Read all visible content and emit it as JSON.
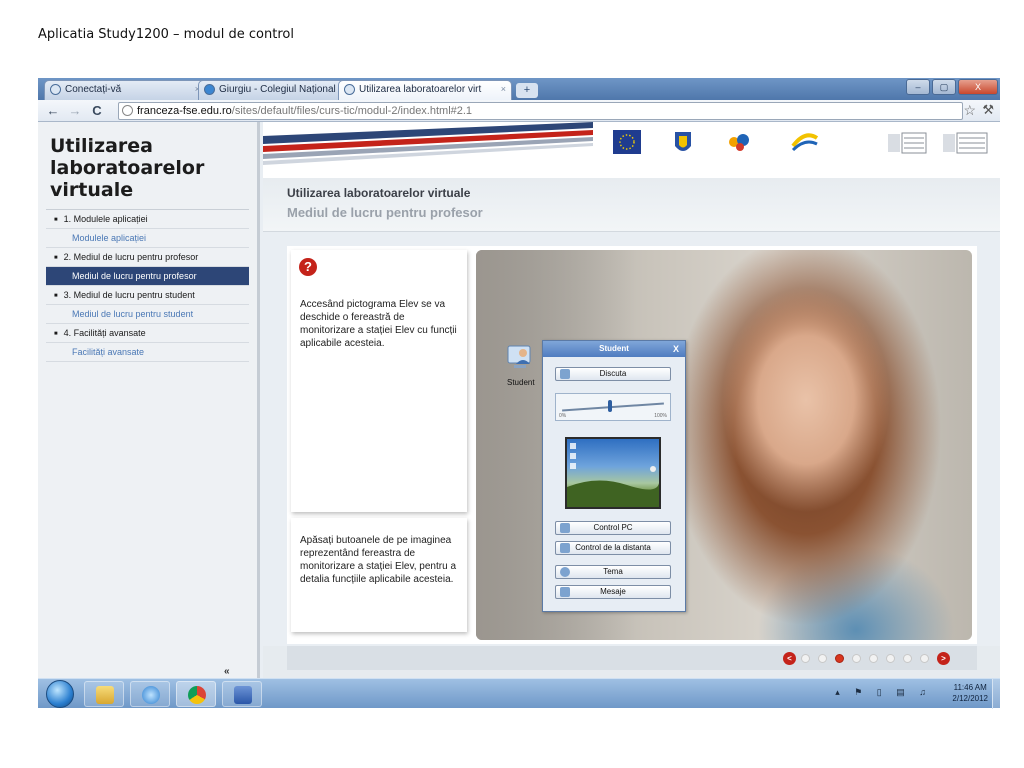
{
  "caption": "Aplicatia Study1200 – modul de control",
  "browser": {
    "tabs": [
      {
        "label": "Conectați-vă",
        "close": "×"
      },
      {
        "label": "Giurgiu - Colegiul Național",
        "close": "×"
      },
      {
        "label": "Utilizarea laboratoarelor virt",
        "close": "×"
      }
    ],
    "new_tab": "+",
    "window_buttons": {
      "minimize": "–",
      "maximize": "▢",
      "close": "X"
    },
    "url_host": "franceza-fse.edu.ro",
    "url_path": "/sites/default/files/curs-tic/modul-2/index.html#2.1"
  },
  "sidebar": {
    "title": "Utilizarea laboratoarelor virtuale",
    "sections": [
      {
        "label": "1. Modulele aplicației",
        "item": "Modulele aplicației",
        "active": false
      },
      {
        "label": "2. Mediul de lucru pentru profesor",
        "item": "Mediul de lucru pentru profesor",
        "active": true
      },
      {
        "label": "3. Mediul de lucru pentru student",
        "item": "Mediul de lucru pentru student",
        "active": false
      },
      {
        "label": "4. Facilități avansate",
        "item": "Facilități avansate",
        "active": false
      }
    ],
    "collapse": "«"
  },
  "header": {
    "title": "Utilizarea laboratoarelor virtuale",
    "subtitle": "Mediul de lucru pentru profesor"
  },
  "cards": {
    "help_glyph": "?",
    "text1": "Accesând pictograma Elev se va deschide o fereastră de monitorizare a stației Elev cu funcții aplicabile acesteia.",
    "text2": "Apăsați butoanele de pe imaginea reprezentând fereastra de monitorizare a stației Elev, pentru a detalia funcțiile aplicabile acesteia."
  },
  "student_panel": {
    "desktop_label": "Student",
    "title": "Student",
    "close": "X",
    "buttons": [
      "Discuta",
      "Control PC",
      "Control de la distanta",
      "Tema",
      "Mesaje"
    ],
    "slider_min": "0%",
    "slider_max": "100%",
    "slider_level": 0.5
  },
  "pager": {
    "pages": 8,
    "current": 3,
    "prev": "<",
    "next": ">"
  },
  "taskbar": {
    "apps": [
      "explorer-folder-icon",
      "internet-explorer-icon",
      "chrome-icon",
      "word-icon"
    ],
    "time": "11:46 AM",
    "date": "2/12/2012"
  },
  "colors": {
    "accent": "#2d4677",
    "red": "#c4231a",
    "link": "#4a78b5"
  }
}
